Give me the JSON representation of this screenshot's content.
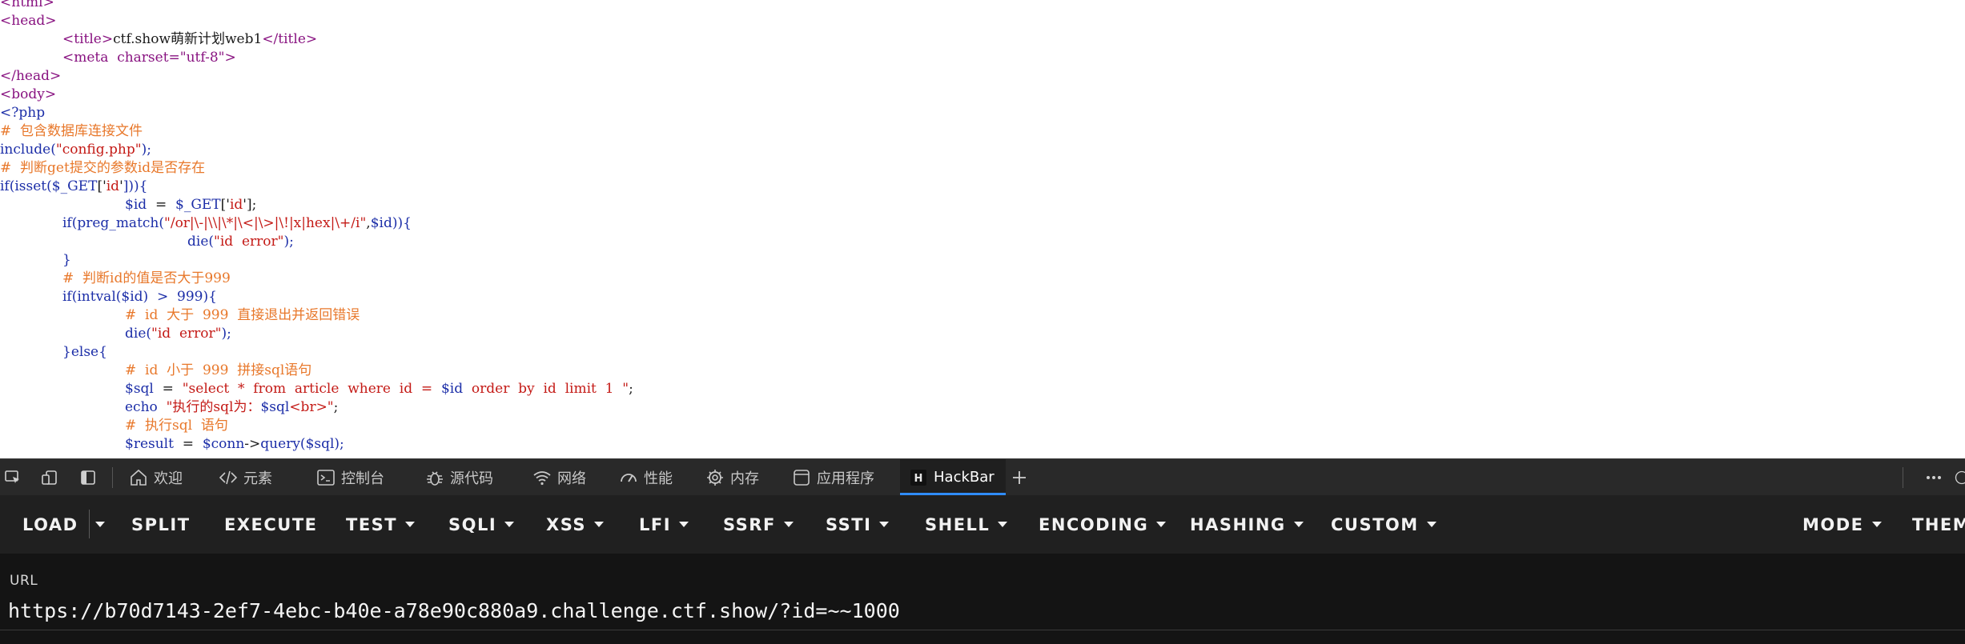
{
  "source_code": [
    {
      "indent": 0,
      "tokens": [
        {
          "c": "c-tag",
          "t": "<html>"
        }
      ]
    },
    {
      "indent": 0,
      "tokens": [
        {
          "c": "c-tag",
          "t": "<head>"
        }
      ]
    },
    {
      "indent": 1,
      "tokens": [
        {
          "c": "c-tag",
          "t": "<title>"
        },
        {
          "c": "c-txt",
          "t": "ctf.show萌新计划web1"
        },
        {
          "c": "c-tag",
          "t": "</title>"
        }
      ]
    },
    {
      "indent": 1,
      "tokens": [
        {
          "c": "c-tag",
          "t": "<meta  charset=\"utf-8\">"
        }
      ]
    },
    {
      "indent": 0,
      "tokens": [
        {
          "c": "c-tag",
          "t": "</head>"
        }
      ]
    },
    {
      "indent": 0,
      "tokens": [
        {
          "c": "c-tag",
          "t": "<body>"
        }
      ]
    },
    {
      "indent": 0,
      "tokens": [
        {
          "c": "c-kw",
          "t": "<?php"
        }
      ]
    },
    {
      "indent": 0,
      "tokens": [
        {
          "c": "c-com",
          "t": "#  包含数据库连接文件"
        }
      ]
    },
    {
      "indent": 0,
      "tokens": [
        {
          "c": "c-fn",
          "t": "include("
        },
        {
          "c": "c-str",
          "t": "\"config.php\""
        },
        {
          "c": "c-fn",
          "t": ");"
        }
      ]
    },
    {
      "indent": 0,
      "tokens": [
        {
          "c": "c-com",
          "t": "#  判断get提交的参数id是否存在"
        }
      ]
    },
    {
      "indent": 0,
      "tokens": [
        {
          "c": "c-fn",
          "t": "if(isset("
        },
        {
          "c": "c-var",
          "t": "$_GET"
        },
        {
          "c": "c-op",
          "t": "['"
        },
        {
          "c": "c-str",
          "t": "id"
        },
        {
          "c": "c-op",
          "t": "'"
        },
        {
          "c": "c-fn",
          "t": "])){"
        }
      ]
    },
    {
      "indent": 2,
      "tokens": [
        {
          "c": "c-var",
          "t": "$id"
        },
        {
          "c": "c-op",
          "t": "  =  "
        },
        {
          "c": "c-var",
          "t": "$_GET"
        },
        {
          "c": "c-op",
          "t": "['"
        },
        {
          "c": "c-str",
          "t": "id"
        },
        {
          "c": "c-op",
          "t": "'];"
        }
      ]
    },
    {
      "indent": 1,
      "tokens": [
        {
          "c": "c-fn",
          "t": "if(preg_match("
        },
        {
          "c": "c-str",
          "t": "\"/or|\\-|\\\\|\\*|\\<|\\>|\\!|x|hex|\\+/i\""
        },
        {
          "c": "c-op",
          "t": ","
        },
        {
          "c": "c-var",
          "t": "$id"
        },
        {
          "c": "c-fn",
          "t": ")){"
        }
      ]
    },
    {
      "indent": 3,
      "tokens": [
        {
          "c": "c-fn",
          "t": "die("
        },
        {
          "c": "c-str",
          "t": "\"id  error\""
        },
        {
          "c": "c-fn",
          "t": ");"
        }
      ]
    },
    {
      "indent": 1,
      "tokens": [
        {
          "c": "c-fn",
          "t": "}"
        }
      ]
    },
    {
      "indent": 1,
      "tokens": [
        {
          "c": "c-com",
          "t": "#  判断id的值是否大于999"
        }
      ]
    },
    {
      "indent": 1,
      "tokens": [
        {
          "c": "c-fn",
          "t": "if(intval("
        },
        {
          "c": "c-var",
          "t": "$id"
        },
        {
          "c": "c-fn",
          "t": ")  >  999){"
        }
      ]
    },
    {
      "indent": 2,
      "tokens": [
        {
          "c": "c-com",
          "t": "#  id  大于  999  直接退出并返回错误"
        }
      ]
    },
    {
      "indent": 2,
      "tokens": [
        {
          "c": "c-fn",
          "t": "die("
        },
        {
          "c": "c-str",
          "t": "\"id  error\""
        },
        {
          "c": "c-fn",
          "t": ");"
        }
      ]
    },
    {
      "indent": 1,
      "tokens": [
        {
          "c": "c-fn",
          "t": "}else{"
        }
      ]
    },
    {
      "indent": 2,
      "tokens": [
        {
          "c": "c-com",
          "t": "#  id  小于  999  拼接sql语句"
        }
      ]
    },
    {
      "indent": 2,
      "tokens": [
        {
          "c": "c-var",
          "t": "$sql"
        },
        {
          "c": "c-op",
          "t": "  =  "
        },
        {
          "c": "c-str",
          "t": "\"select  *  from  article  where  id  =  "
        },
        {
          "c": "c-var",
          "t": "$id"
        },
        {
          "c": "c-str",
          "t": "  order  by  id  limit  1  \""
        },
        {
          "c": "c-op",
          "t": ";"
        }
      ]
    },
    {
      "indent": 2,
      "tokens": [
        {
          "c": "c-fn",
          "t": "echo  "
        },
        {
          "c": "c-str",
          "t": "\"执行的sql为："
        },
        {
          "c": "c-var",
          "t": "$sql"
        },
        {
          "c": "c-str",
          "t": "<br>\""
        },
        {
          "c": "c-op",
          "t": ";"
        }
      ]
    },
    {
      "indent": 2,
      "tokens": [
        {
          "c": "c-com",
          "t": "#  执行sql  语句"
        }
      ]
    },
    {
      "indent": 2,
      "tokens": [
        {
          "c": "c-var",
          "t": "$result"
        },
        {
          "c": "c-op",
          "t": "  =  "
        },
        {
          "c": "c-var",
          "t": "$conn"
        },
        {
          "c": "c-op",
          "t": "->"
        },
        {
          "c": "c-fn",
          "t": "query("
        },
        {
          "c": "c-var",
          "t": "$sql"
        },
        {
          "c": "c-fn",
          "t": ");"
        }
      ]
    }
  ],
  "devtools": {
    "tabs": [
      {
        "id": "welcome",
        "label": "欢迎",
        "icon": "home-icon"
      },
      {
        "id": "elements",
        "label": "元素",
        "icon": "code-icon"
      },
      {
        "id": "console",
        "label": "控制台",
        "icon": "console-icon"
      },
      {
        "id": "sources",
        "label": "源代码",
        "icon": "bug-icon"
      },
      {
        "id": "network",
        "label": "网络",
        "icon": "wifi-icon"
      },
      {
        "id": "performance",
        "label": "性能",
        "icon": "gauge-icon"
      },
      {
        "id": "memory",
        "label": "内存",
        "icon": "chip-icon"
      },
      {
        "id": "application",
        "label": "应用程序",
        "icon": "app-icon"
      },
      {
        "id": "hackbar",
        "label": "HackBar",
        "icon": "hackbar-icon",
        "active": true
      }
    ]
  },
  "hackbar": {
    "menu": {
      "load": "LOAD",
      "split": "SPLIT",
      "execute": "EXECUTE",
      "test": "TEST",
      "sqli": "SQLI",
      "xss": "XSS",
      "lfi": "LFI",
      "ssrf": "SSRF",
      "ssti": "SSTI",
      "shell": "SHELL",
      "encoding": "ENCODING",
      "hashing": "HASHING",
      "custom": "CUSTOM",
      "mode": "MODE",
      "theme": "THEM"
    },
    "url_label": "URL",
    "url_value": "https://b70d7143-2ef7-4ebc-b40e-a78e90c880a9.challenge.ctf.show/?id=~~1000"
  }
}
